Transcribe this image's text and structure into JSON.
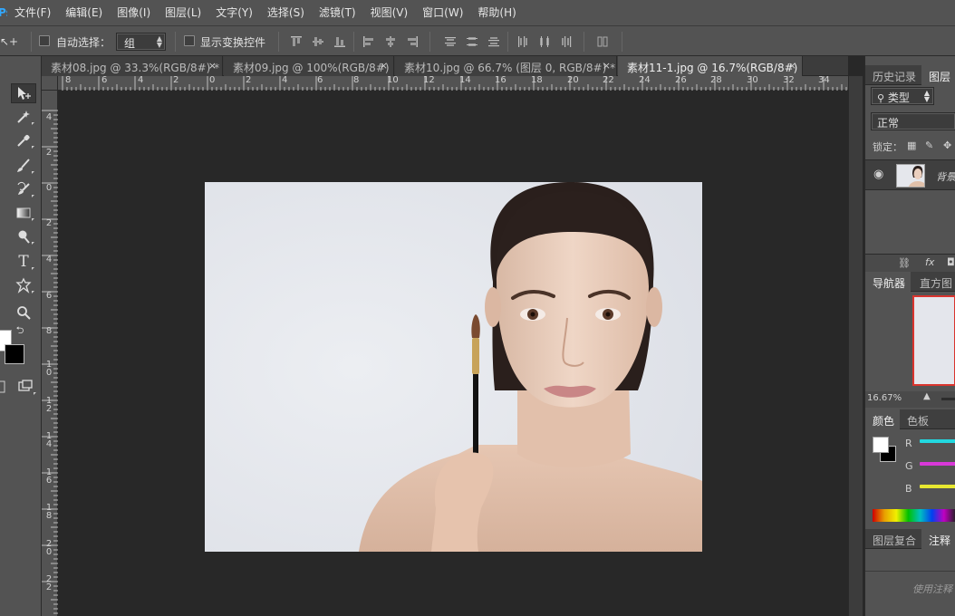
{
  "menubar": {
    "logo": "Ps",
    "items": [
      "文件(F)",
      "编辑(E)",
      "图像(I)",
      "图层(L)",
      "文字(Y)",
      "选择(S)",
      "滤镜(T)",
      "视图(V)",
      "窗口(W)",
      "帮助(H)"
    ]
  },
  "options": {
    "move_tool_glyph": "↖+",
    "auto_select_label": "自动选择：",
    "auto_select_value": "组",
    "show_transform_label": "显示变换控件"
  },
  "tabs": [
    {
      "label": "素材08.jpg @ 33.3%(RGB/8#) *",
      "close": "×"
    },
    {
      "label": "素材09.jpg @ 100%(RGB/8#)",
      "close": "×"
    },
    {
      "label": "素材10.jpg @ 66.7% (图层 0, RGB/8#) *",
      "close": "×"
    },
    {
      "label": "素材11-1.jpg @ 16.7%(RGB/8#)",
      "close": "×"
    }
  ],
  "ruler": {
    "h_labels": [
      "8",
      "6",
      "4",
      "2",
      "0",
      "2",
      "4",
      "6",
      "8",
      "10",
      "12",
      "14",
      "16",
      "18",
      "20",
      "22",
      "24",
      "26",
      "28",
      "30",
      "32",
      "34"
    ],
    "v_labels": [
      "4",
      "2",
      "0",
      "2",
      "4",
      "6",
      "8",
      "1 0",
      "1 2",
      "1 4",
      "1 6",
      "1 8",
      "2 0",
      "2 2"
    ]
  },
  "toolbox": {
    "text_tool_glyph": "T"
  },
  "panels": {
    "top_tabs": [
      "历史记录",
      "图层"
    ],
    "filter_kind": "类型",
    "blend_mode": "正常",
    "lock_label": "锁定：",
    "layer_name": "背景",
    "layer_fx": "fx",
    "nav_tabs": [
      "导航器",
      "直方图"
    ],
    "zoom": "16.67%",
    "color_tabs": [
      "颜色",
      "色板"
    ],
    "channels": [
      "R",
      "G",
      "B"
    ],
    "bottom_tabs": [
      "图层复合",
      "注释"
    ],
    "notes_placeholder": "使用注释"
  },
  "colors": {
    "foreground": "#ffffff",
    "background": "#000000",
    "r_slider": "#22d8e0",
    "g_slider": "#d838d8",
    "b_slider": "#e8e830",
    "nav_frame": "#d9342e"
  }
}
